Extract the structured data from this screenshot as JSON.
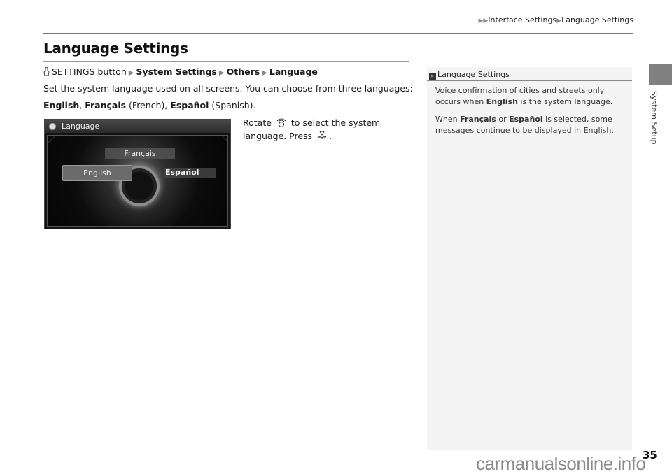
{
  "header": {
    "breadcrumb": [
      "Interface Settings",
      "Language Settings"
    ]
  },
  "title": "Language Settings",
  "path": {
    "start": "SETTINGS button",
    "steps": [
      "System Settings",
      "Others",
      "Language"
    ]
  },
  "description": {
    "line1": "Set the system language used on all screens. You can choose from three languages:",
    "lang_en": "English",
    "sep": ", ",
    "lang_fr": "Français",
    "fr_note": " (French), ",
    "lang_es": "Español",
    "es_note": " (Spanish)."
  },
  "step": {
    "part1": "Rotate",
    "part2": "to select the system language. Press",
    "part3": "."
  },
  "screen": {
    "title": "Language",
    "options": {
      "french": "Français",
      "english": "English",
      "spanish": "Español"
    },
    "selected": "English"
  },
  "note": {
    "heading": "Language Settings",
    "p1_a": "Voice confirmation of cities and streets only occurs when ",
    "p1_b": "English",
    "p1_c": " is the system language.",
    "p2_a": "When ",
    "p2_b": "Français",
    "p2_c": " or ",
    "p2_d": "Español",
    "p2_e": " is selected, some messages continue to be displayed in English."
  },
  "side_tab": {
    "label": "System Setup"
  },
  "page_number": "35",
  "watermark": "carmanualsonline.info"
}
